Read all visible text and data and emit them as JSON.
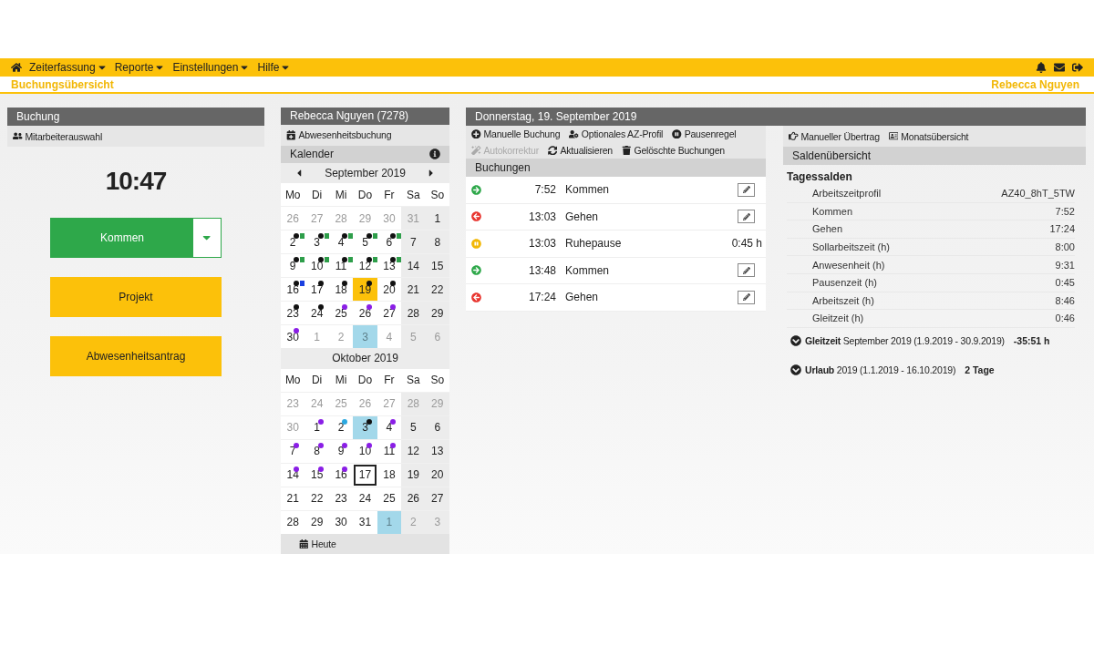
{
  "nav": {
    "menus": [
      "Zeiterfassung",
      "Reporte",
      "Einstellungen",
      "Hilfe"
    ]
  },
  "breadcrumb": "Buchungsübersicht",
  "user": "Rebecca Nguyen",
  "booking_panel": {
    "title": "Buchung",
    "toolbar": "Mitarbeiterauswahl",
    "clock": "10:47",
    "buttons": [
      {
        "label": "Kommen",
        "kind": "split"
      },
      {
        "label": "Projekt",
        "kind": "plain"
      },
      {
        "label": "Abwesenheitsantrag",
        "kind": "plain"
      }
    ]
  },
  "calendar_panel": {
    "title": "Rebecca Nguyen (7278)",
    "action": "Abwesenheitsbuchung",
    "section": "Kalender",
    "months": [
      {
        "title": "September 2019",
        "arrows": true,
        "weekdays": [
          "Mo",
          "Di",
          "Mi",
          "Do",
          "Fr",
          "Sa",
          "So"
        ],
        "weeks": [
          [
            {
              "kind": "plain",
              "label": "26",
              "muted": true,
              "selected": false
            },
            {
              "kind": "plain",
              "label": "27",
              "muted": true,
              "selected": false
            },
            {
              "kind": "plain",
              "label": "28",
              "muted": true,
              "selected": false
            },
            {
              "kind": "plain",
              "label": "29",
              "muted": true,
              "selected": false
            },
            {
              "kind": "plain",
              "label": "30",
              "muted": true,
              "selected": false
            },
            {
              "kind": "plain",
              "label": "31",
              "muted": true,
              "selected": false
            },
            {
              "kind": "plain",
              "label": "1",
              "muted": false,
              "selected": false
            }
          ],
          [
            {
              "kind": "plain",
              "label": "2",
              "muted": false,
              "selected": false,
              "marks": [
                {
                  "kind": "dot",
                  "color": "#111111"
                },
                {
                  "kind": "square",
                  "color": "#2e9e4a"
                }
              ]
            },
            {
              "kind": "plain",
              "label": "3",
              "muted": false,
              "selected": false,
              "marks": [
                {
                  "kind": "dot",
                  "color": "#111111"
                },
                {
                  "kind": "square",
                  "color": "#2e9e4a"
                }
              ]
            },
            {
              "kind": "plain",
              "label": "4",
              "muted": false,
              "selected": false,
              "marks": [
                {
                  "kind": "dot",
                  "color": "#111111"
                },
                {
                  "kind": "square",
                  "color": "#2e9e4a"
                }
              ]
            },
            {
              "kind": "plain",
              "label": "5",
              "muted": false,
              "selected": false,
              "marks": [
                {
                  "kind": "dot",
                  "color": "#111111"
                },
                {
                  "kind": "square",
                  "color": "#2e9e4a"
                }
              ]
            },
            {
              "kind": "plain",
              "label": "6",
              "muted": false,
              "selected": false,
              "marks": [
                {
                  "kind": "dot",
                  "color": "#111111"
                },
                {
                  "kind": "square",
                  "color": "#2e9e4a"
                }
              ]
            },
            {
              "kind": "plain",
              "label": "7",
              "muted": false,
              "selected": false
            },
            {
              "kind": "plain",
              "label": "8",
              "muted": false,
              "selected": false
            }
          ],
          [
            {
              "kind": "plain",
              "label": "9",
              "muted": false,
              "selected": false,
              "marks": [
                {
                  "kind": "dot",
                  "color": "#111111"
                },
                {
                  "kind": "square",
                  "color": "#2e9e4a"
                }
              ]
            },
            {
              "kind": "plain",
              "label": "10",
              "muted": false,
              "selected": false,
              "marks": [
                {
                  "kind": "dot",
                  "color": "#111111"
                },
                {
                  "kind": "square",
                  "color": "#2e9e4a"
                }
              ]
            },
            {
              "kind": "plain",
              "label": "11",
              "muted": false,
              "selected": false,
              "marks": [
                {
                  "kind": "dot",
                  "color": "#111111"
                },
                {
                  "kind": "square",
                  "color": "#2e9e4a"
                }
              ]
            },
            {
              "kind": "plain",
              "label": "12",
              "muted": false,
              "selected": false,
              "marks": [
                {
                  "kind": "dot",
                  "color": "#111111"
                },
                {
                  "kind": "square",
                  "color": "#2e9e4a"
                }
              ]
            },
            {
              "kind": "plain",
              "label": "13",
              "muted": false,
              "selected": false,
              "marks": [
                {
                  "kind": "dot",
                  "color": "#111111"
                },
                {
                  "kind": "square",
                  "color": "#2e9e4a"
                }
              ]
            },
            {
              "kind": "plain",
              "label": "14",
              "muted": false,
              "selected": false
            },
            {
              "kind": "plain",
              "label": "15",
              "muted": false,
              "selected": false
            }
          ],
          [
            {
              "kind": "plain",
              "label": "16",
              "muted": false,
              "selected": false,
              "marks": [
                {
                  "kind": "dot",
                  "color": "#111111"
                },
                {
                  "kind": "square",
                  "color": "#1a3fe0"
                }
              ]
            },
            {
              "kind": "plain",
              "label": "17",
              "muted": false,
              "selected": false,
              "marks": [
                {
                  "kind": "dot",
                  "color": "#111111"
                }
              ]
            },
            {
              "kind": "plain",
              "label": "18",
              "muted": false,
              "selected": false,
              "marks": [
                {
                  "kind": "dot",
                  "color": "#111111"
                }
              ]
            },
            {
              "kind": "plain",
              "label": "19",
              "muted": false,
              "selected": true,
              "marks": [
                {
                  "kind": "dot",
                  "color": "#111111"
                }
              ]
            },
            {
              "kind": "plain",
              "label": "20",
              "muted": false,
              "selected": false,
              "marks": [
                {
                  "kind": "dot",
                  "color": "#111111"
                }
              ]
            },
            {
              "kind": "plain",
              "label": "21",
              "muted": false,
              "selected": false
            },
            {
              "kind": "plain",
              "label": "22",
              "muted": false,
              "selected": false
            }
          ],
          [
            {
              "kind": "plain",
              "label": "23",
              "muted": false,
              "selected": false,
              "marks": [
                {
                  "kind": "dot",
                  "color": "#111111"
                }
              ]
            },
            {
              "kind": "plain",
              "label": "24",
              "muted": false,
              "selected": false,
              "marks": [
                {
                  "kind": "dot",
                  "color": "#111111"
                }
              ]
            },
            {
              "kind": "plain",
              "label": "25",
              "muted": false,
              "selected": false,
              "marks": [
                {
                  "kind": "dot",
                  "color": "#8a1ee6"
                }
              ]
            },
            {
              "kind": "plain",
              "label": "26",
              "muted": false,
              "selected": false,
              "marks": [
                {
                  "kind": "dot",
                  "color": "#8a1ee6"
                }
              ]
            },
            {
              "kind": "plain",
              "label": "27",
              "muted": false,
              "selected": false,
              "marks": [
                {
                  "kind": "dot",
                  "color": "#8a1ee6"
                }
              ]
            },
            {
              "kind": "plain",
              "label": "28",
              "muted": false,
              "selected": false
            },
            {
              "kind": "plain",
              "label": "29",
              "muted": false,
              "selected": false
            }
          ],
          [
            {
              "kind": "plain",
              "label": "30",
              "muted": false,
              "selected": false,
              "marks": [
                {
                  "kind": "dot",
                  "color": "#8a1ee6"
                }
              ]
            },
            {
              "kind": "plain",
              "label": "1",
              "muted": true,
              "selected": false
            },
            {
              "kind": "plain",
              "label": "2",
              "muted": true,
              "selected": false
            },
            {
              "kind": "holiday",
              "label": "3",
              "muted": true,
              "selected": false
            },
            {
              "kind": "plain",
              "label": "4",
              "muted": true,
              "selected": false
            },
            {
              "kind": "plain",
              "label": "5",
              "muted": true,
              "selected": false
            },
            {
              "kind": "plain",
              "label": "6",
              "muted": true,
              "selected": false
            }
          ]
        ]
      },
      {
        "title": "Oktober 2019",
        "arrows": false,
        "weekdays": [
          "Mo",
          "Di",
          "Mi",
          "Do",
          "Fr",
          "Sa",
          "So"
        ],
        "weeks": [
          [
            {
              "kind": "plain",
              "label": "23",
              "muted": true,
              "selected": false
            },
            {
              "kind": "plain",
              "label": "24",
              "muted": true,
              "selected": false
            },
            {
              "kind": "plain",
              "label": "25",
              "muted": true,
              "selected": false
            },
            {
              "kind": "plain",
              "label": "26",
              "muted": true,
              "selected": false
            },
            {
              "kind": "plain",
              "label": "27",
              "muted": true,
              "selected": false
            },
            {
              "kind": "plain",
              "label": "28",
              "muted": true,
              "selected": false
            },
            {
              "kind": "plain",
              "label": "29",
              "muted": true,
              "selected": false
            }
          ],
          [
            {
              "kind": "plain",
              "label": "30",
              "muted": true,
              "selected": false
            },
            {
              "kind": "plain",
              "label": "1",
              "muted": false,
              "selected": false,
              "marks": [
                {
                  "kind": "dot",
                  "color": "#8a1ee6"
                }
              ]
            },
            {
              "kind": "plain",
              "label": "2",
              "muted": false,
              "selected": false,
              "marks": [
                {
                  "kind": "dot",
                  "color": "#2ba8e0"
                }
              ]
            },
            {
              "kind": "holiday",
              "label": "3",
              "muted": false,
              "selected": false,
              "marks": [
                {
                  "kind": "dot",
                  "color": "#111111"
                }
              ]
            },
            {
              "kind": "plain",
              "label": "4",
              "muted": false,
              "selected": false,
              "marks": [
                {
                  "kind": "dot",
                  "color": "#8a1ee6"
                }
              ]
            },
            {
              "kind": "plain",
              "label": "5",
              "muted": false,
              "selected": false
            },
            {
              "kind": "plain",
              "label": "6",
              "muted": false,
              "selected": false
            }
          ],
          [
            {
              "kind": "plain",
              "label": "7",
              "muted": false,
              "selected": false,
              "marks": [
                {
                  "kind": "dot",
                  "color": "#8a1ee6"
                }
              ]
            },
            {
              "kind": "plain",
              "label": "8",
              "muted": false,
              "selected": false,
              "marks": [
                {
                  "kind": "dot",
                  "color": "#8a1ee6"
                }
              ]
            },
            {
              "kind": "plain",
              "label": "9",
              "muted": false,
              "selected": false,
              "marks": [
                {
                  "kind": "dot",
                  "color": "#8a1ee6"
                }
              ]
            },
            {
              "kind": "plain",
              "label": "10",
              "muted": false,
              "selected": false,
              "marks": [
                {
                  "kind": "dot",
                  "color": "#8a1ee6"
                }
              ]
            },
            {
              "kind": "plain",
              "label": "11",
              "muted": false,
              "selected": false,
              "marks": [
                {
                  "kind": "dot",
                  "color": "#8a1ee6"
                }
              ]
            },
            {
              "kind": "plain",
              "label": "12",
              "muted": false,
              "selected": false
            },
            {
              "kind": "plain",
              "label": "13",
              "muted": false,
              "selected": false
            }
          ],
          [
            {
              "kind": "plain",
              "label": "14",
              "muted": false,
              "selected": false,
              "marks": [
                {
                  "kind": "dot",
                  "color": "#8a1ee6"
                }
              ]
            },
            {
              "kind": "plain",
              "label": "15",
              "muted": false,
              "selected": false,
              "marks": [
                {
                  "kind": "dot",
                  "color": "#8a1ee6"
                }
              ]
            },
            {
              "kind": "plain",
              "label": "16",
              "muted": false,
              "selected": false,
              "marks": [
                {
                  "kind": "dot",
                  "color": "#8a1ee6"
                }
              ]
            },
            {
              "kind": "today",
              "label": "17",
              "muted": false,
              "selected": false
            },
            {
              "kind": "plain",
              "label": "18",
              "muted": false,
              "selected": false
            },
            {
              "kind": "plain",
              "label": "19",
              "muted": false,
              "selected": false
            },
            {
              "kind": "plain",
              "label": "20",
              "muted": false,
              "selected": false
            }
          ],
          [
            {
              "kind": "plain",
              "label": "21",
              "muted": false,
              "selected": false
            },
            {
              "kind": "plain",
              "label": "22",
              "muted": false,
              "selected": false
            },
            {
              "kind": "plain",
              "label": "23",
              "muted": false,
              "selected": false
            },
            {
              "kind": "plain",
              "label": "24",
              "muted": false,
              "selected": false
            },
            {
              "kind": "plain",
              "label": "25",
              "muted": false,
              "selected": false
            },
            {
              "kind": "plain",
              "label": "26",
              "muted": false,
              "selected": false
            },
            {
              "kind": "plain",
              "label": "27",
              "muted": false,
              "selected": false
            }
          ],
          [
            {
              "kind": "plain",
              "label": "28",
              "muted": false,
              "selected": false
            },
            {
              "kind": "plain",
              "label": "29",
              "muted": false,
              "selected": false
            },
            {
              "kind": "plain",
              "label": "30",
              "muted": false,
              "selected": false
            },
            {
              "kind": "plain",
              "label": "31",
              "muted": false,
              "selected": false
            },
            {
              "kind": "holiday",
              "label": "1",
              "muted": true,
              "selected": false
            },
            {
              "kind": "plain",
              "label": "2",
              "muted": true,
              "selected": false
            },
            {
              "kind": "plain",
              "label": "3",
              "muted": true,
              "selected": false
            }
          ]
        ]
      }
    ],
    "today_button": "Heute"
  },
  "day_panel": {
    "title": "Donnerstag, 19. September 2019",
    "actions": [
      {
        "label": "Manuelle Buchung",
        "disabled": false
      },
      {
        "label": "Optionales AZ-Profil",
        "disabled": false
      },
      {
        "label": "Pausenregel",
        "disabled": false
      },
      {
        "label": "Autokorrektur",
        "disabled": true
      },
      {
        "label": "Aktualisieren",
        "disabled": false
      },
      {
        "label": "Gelöschte Buchungen",
        "disabled": false
      }
    ],
    "section": "Buchungen",
    "bookings": [
      {
        "kind": "in",
        "time": "7:52",
        "label": "Kommen"
      },
      {
        "kind": "out",
        "time": "13:03",
        "label": "Gehen"
      },
      {
        "kind": "pause",
        "time": "13:03",
        "label": "Ruhepause",
        "duration": "0:45 h"
      },
      {
        "kind": "in",
        "time": "13:48",
        "label": "Kommen"
      },
      {
        "kind": "out",
        "time": "17:24",
        "label": "Gehen"
      }
    ]
  },
  "balance_panel": {
    "actions": [
      "Manueller Übertrag",
      "Monatsübersicht"
    ],
    "section": "Saldenübersicht",
    "heading": "Tagessalden",
    "rows": [
      {
        "label": "Arbeitszeitprofil",
        "value": "AZ40_8hT_5TW"
      },
      {
        "label": "Kommen",
        "value": "7:52"
      },
      {
        "label": "Gehen",
        "value": "17:24"
      },
      {
        "label": "Sollarbeitszeit (h)",
        "value": "8:00"
      },
      {
        "label": "Anwesenheit (h)",
        "value": "9:31"
      },
      {
        "label": "Pausenzeit (h)",
        "value": "0:45"
      },
      {
        "label": "Arbeitszeit (h)",
        "value": "8:46"
      },
      {
        "label": "Gleitzeit (h)",
        "value": "0:46"
      }
    ],
    "summaries": [
      {
        "text": "**Gleitzeit** September 2019 (1.9.2019 - 30.9.2019)",
        "value": "-35:51 h"
      },
      {
        "text": "**Urlaub** 2019 (1.1.2019 - 16.10.2019)",
        "value": "2 Tage"
      }
    ]
  }
}
